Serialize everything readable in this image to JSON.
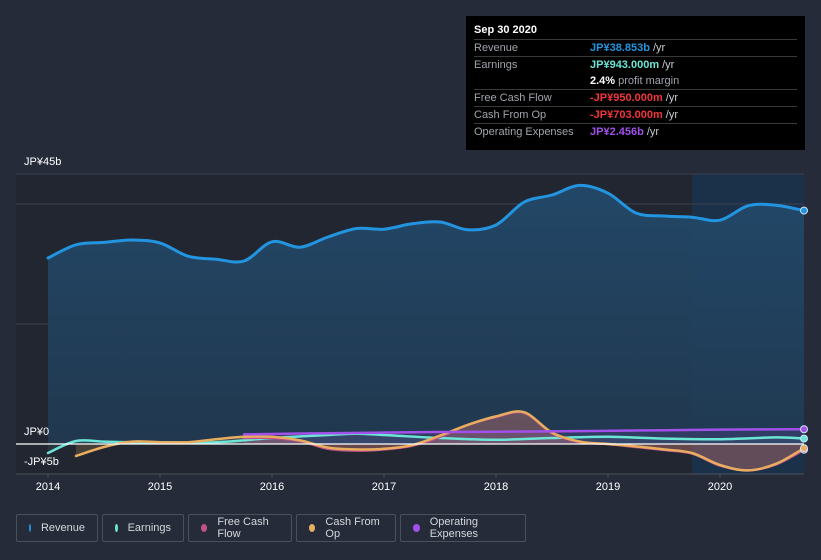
{
  "tooltip": {
    "date": "Sep 30 2020",
    "rows": [
      {
        "label": "Revenue",
        "value": "JP¥38.853b",
        "unit": "/yr",
        "color": "#2394df"
      },
      {
        "label": "Earnings",
        "value": "JP¥943.000m",
        "unit": "/yr",
        "color": "#6ce5d6"
      },
      {
        "label": "",
        "value": "2.4%",
        "unit": "profit margin",
        "color": "#ffffff"
      },
      {
        "label": "Free Cash Flow",
        "value": "-JP¥950.000m",
        "unit": "/yr",
        "color": "#f0353c"
      },
      {
        "label": "Cash From Op",
        "value": "-JP¥703.000m",
        "unit": "/yr",
        "color": "#f0353c"
      },
      {
        "label": "Operating Expenses",
        "value": "JP¥2.456b",
        "unit": "/yr",
        "color": "#a150ea"
      }
    ]
  },
  "legend": [
    {
      "label": "Revenue",
      "color": "#2394df"
    },
    {
      "label": "Earnings",
      "color": "#6ce5d6"
    },
    {
      "label": "Free Cash Flow",
      "color": "#c2508a"
    },
    {
      "label": "Cash From Op",
      "color": "#e8ad5f"
    },
    {
      "label": "Operating Expenses",
      "color": "#a150ea"
    }
  ],
  "chart_data": {
    "type": "area",
    "title": "",
    "xlabel": "",
    "ylabel": "",
    "y_tick_labels": [
      "JP¥45b",
      "JP¥0",
      "-JP¥5b"
    ],
    "x_tick_labels": [
      "2014",
      "2015",
      "2016",
      "2017",
      "2018",
      "2019",
      "2020"
    ],
    "xlim": [
      2014.0,
      2020.75
    ],
    "ylim": [
      -5,
      45
    ],
    "highlight_from": 2019.75,
    "series": [
      {
        "name": "Revenue",
        "color": "#2394df",
        "x": [
          2014.0,
          2014.25,
          2014.5,
          2014.75,
          2015.0,
          2015.25,
          2015.5,
          2015.75,
          2016.0,
          2016.25,
          2016.5,
          2016.75,
          2017.0,
          2017.25,
          2017.5,
          2017.75,
          2018.0,
          2018.25,
          2018.5,
          2018.75,
          2019.0,
          2019.25,
          2019.5,
          2019.75,
          2020.0,
          2020.25,
          2020.5,
          2020.75
        ],
        "values": [
          31.0,
          33.2,
          33.6,
          34.0,
          33.5,
          31.3,
          30.8,
          30.5,
          33.7,
          32.8,
          34.5,
          35.9,
          35.8,
          36.7,
          37.0,
          35.7,
          36.5,
          40.3,
          41.5,
          43.1,
          41.8,
          38.5,
          38.0,
          37.8,
          37.3,
          39.7,
          39.8,
          38.9
        ]
      },
      {
        "name": "Earnings",
        "color": "#6ce5d6",
        "x": [
          2014.0,
          2014.25,
          2014.5,
          2014.75,
          2015.0,
          2015.5,
          2016.0,
          2016.5,
          2016.75,
          2017.0,
          2017.5,
          2018.0,
          2018.5,
          2019.0,
          2019.5,
          2020.0,
          2020.5,
          2020.75
        ],
        "values": [
          -1.5,
          0.5,
          0.4,
          0.3,
          0.3,
          0.3,
          1.0,
          1.5,
          1.7,
          1.5,
          1.0,
          0.7,
          1.0,
          1.2,
          0.9,
          0.8,
          1.1,
          0.9
        ]
      },
      {
        "name": "Free Cash Flow",
        "color": "#c2508a",
        "x": [
          2015.75,
          2016.0,
          2016.25,
          2016.5,
          2016.75,
          2017.0,
          2017.25,
          2017.5,
          2017.75,
          2018.0,
          2018.25,
          2018.5,
          2018.75,
          2019.0,
          2019.25,
          2019.5,
          2019.75,
          2020.0,
          2020.25,
          2020.5,
          2020.75
        ],
        "values": [
          1.0,
          1.0,
          0.5,
          -0.8,
          -1.1,
          -0.9,
          -0.3,
          1.2,
          3.2,
          4.5,
          5.2,
          1.8,
          0.3,
          0.0,
          -0.5,
          -1.0,
          -1.6,
          -3.6,
          -4.4,
          -3.4,
          -0.95
        ]
      },
      {
        "name": "Cash From Op",
        "color": "#e8ad5f",
        "x": [
          2014.25,
          2014.5,
          2014.75,
          2015.0,
          2015.25,
          2015.5,
          2015.75,
          2016.0,
          2016.25,
          2016.5,
          2016.75,
          2017.0,
          2017.25,
          2017.5,
          2017.75,
          2018.0,
          2018.25,
          2018.5,
          2018.75,
          2019.0,
          2019.25,
          2019.5,
          2019.75,
          2020.0,
          2020.25,
          2020.5,
          2020.75
        ],
        "values": [
          -2.0,
          -0.5,
          0.4,
          0.3,
          0.3,
          0.8,
          1.2,
          1.2,
          0.6,
          -0.6,
          -0.9,
          -0.8,
          -0.2,
          1.4,
          3.2,
          4.6,
          5.3,
          1.9,
          0.4,
          0.0,
          -0.4,
          -0.9,
          -1.5,
          -3.5,
          -4.4,
          -3.3,
          -0.7
        ]
      },
      {
        "name": "Operating Expenses",
        "color": "#a150ea",
        "x": [
          2015.75,
          2016.5,
          2017.5,
          2018.5,
          2019.5,
          2020.0,
          2020.75
        ],
        "values": [
          1.6,
          1.8,
          2.0,
          2.1,
          2.3,
          2.4,
          2.456
        ]
      }
    ]
  }
}
